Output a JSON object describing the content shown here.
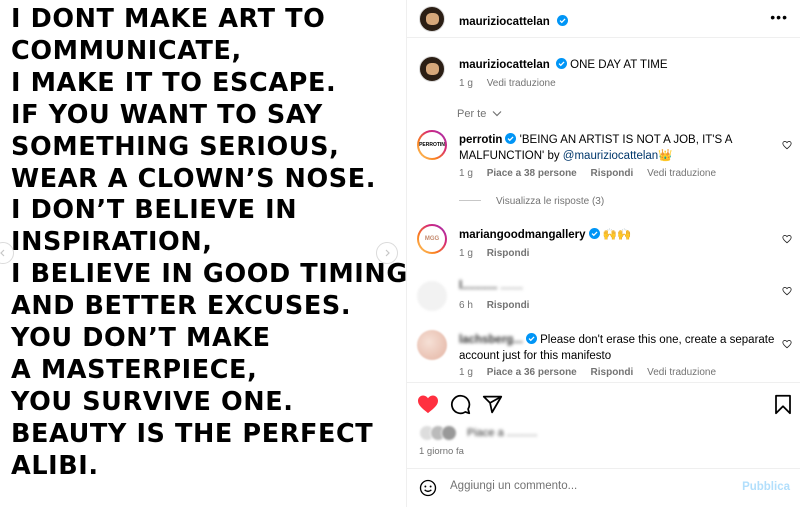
{
  "post": {
    "manifesto_lines": [
      "I DONT MAKE ART TO",
      "COMMUNICATE,",
      "I MAKE IT TO ESCAPE.",
      "IF YOU WANT TO SAY",
      "SOMETHING SERIOUS,",
      "WEAR A CLOWN’S NOSE.",
      "I DON’T BELIEVE IN",
      "INSPIRATION,",
      "I BELIEVE IN GOOD TIMING",
      "AND BETTER EXCUSES.",
      "YOU DON’T MAKE",
      "A MASTERPIECE,",
      "YOU SURVIVE ONE.",
      "BEAUTY IS THE PERFECT",
      "ALIBI."
    ]
  },
  "header": {
    "username": "mauriziocattelan",
    "more_label": "•••"
  },
  "caption": {
    "username": "mauriziocattelan",
    "text": "ONE DAY AT TIME",
    "time": "1 g",
    "translate": "Vedi traduzione"
  },
  "filter": {
    "label": "Per te"
  },
  "comments": [
    {
      "username": "perrotin",
      "avatar_text": "PERROTIN",
      "text": "'BEING AN ARTIST IS NOT A JOB, IT'S A MALFUNCTION' by",
      "mention": "@mauriziocattelan",
      "emoji": "👑",
      "time": "1 g",
      "likes": "Piace a 38 persone",
      "reply": "Rispondi",
      "translate": "Vedi traduzione"
    },
    {
      "username": "mariangoodmangallery",
      "avatar_text": "MGG",
      "text": "🙌🙌",
      "time": "1 g",
      "reply": "Rispondi"
    },
    {
      "username": "l...........",
      "text": ".......",
      "time": "6 h",
      "reply": "Rispondi"
    },
    {
      "username": "lachsberg...",
      "text": "Please don't erase this one, create a separate account just for this manifesto",
      "time": "1 g",
      "likes": "Piace a 36 persone",
      "reply": "Rispondi",
      "translate": "Vedi traduzione"
    }
  ],
  "view_replies": "Visualizza le risposte (3)",
  "likes_summary": "Piace a ..........",
  "post_time": "1 giorno fa",
  "composer": {
    "placeholder": "Aggiungi un commento...",
    "publish": "Pubblica"
  },
  "colors": {
    "like_red": "#ff3040",
    "link_blue": "#00376b",
    "verified_blue": "#0095f6",
    "publish_disabled": "#b2dffc",
    "muted": "#737373"
  },
  "icons": [
    "chevron-left-icon",
    "chevron-right-icon",
    "verified-icon",
    "heart-icon",
    "comment-icon",
    "share-icon",
    "bookmark-icon",
    "emoji-icon",
    "chevron-down-icon"
  ]
}
